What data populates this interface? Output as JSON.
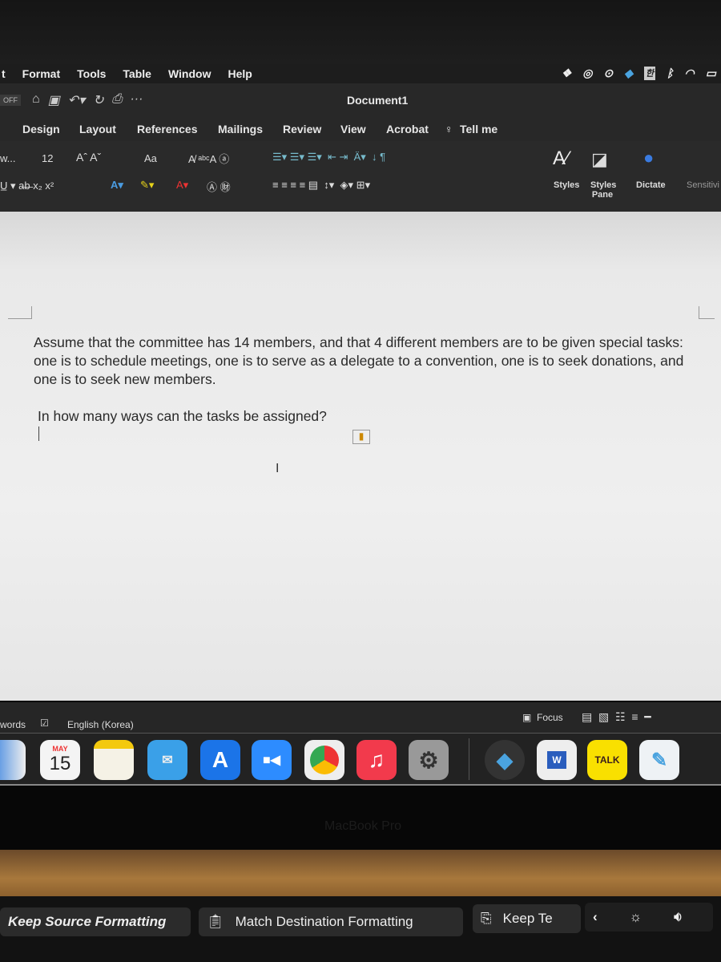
{
  "menubar": {
    "items": [
      "t",
      "Format",
      "Tools",
      "Table",
      "Window",
      "Help"
    ],
    "status_icons": [
      "dropbox-icon",
      "creative-cloud-icon",
      "play-icon",
      "diamond-app-icon",
      "korean-input-icon",
      "bluetooth-icon",
      "airdrop-icon",
      "battery-icon"
    ],
    "korean_input": "한"
  },
  "titlebar": {
    "autosave": "OFF",
    "title": "Document1",
    "more": "···"
  },
  "tabs": [
    "Design",
    "Layout",
    "References",
    "Mailings",
    "Review",
    "View",
    "Acrobat",
    "Tell me"
  ],
  "ribbon": {
    "font_name": "w...",
    "font_size": "12",
    "change_case": "Aa",
    "styles": "Styles",
    "styles_pane": "Styles Pane",
    "dictate": "Dictate",
    "sensitivity": "Sensitivi"
  },
  "document": {
    "paragraph": "Assume that the committee has 14 members, and that 4 different members are to be given special tasks: one is to schedule meetings, one is to serve as a delegate to a convention, one is to seek donations, and one is to seek new members.",
    "question": "In how many ways can the tasks be assigned?"
  },
  "statusbar": {
    "words": "words",
    "language": "English (Korea)",
    "focus": "Focus"
  },
  "dock": {
    "calendar_month": "MAY",
    "calendar_day": "15",
    "talk": "TALK",
    "word": "W"
  },
  "bezel": {
    "label": "MacBook Pro"
  },
  "touchbar": {
    "keep_source": "Keep Source Formatting",
    "match_destination": "Match Destination Formatting",
    "keep_text": "Keep Te"
  }
}
